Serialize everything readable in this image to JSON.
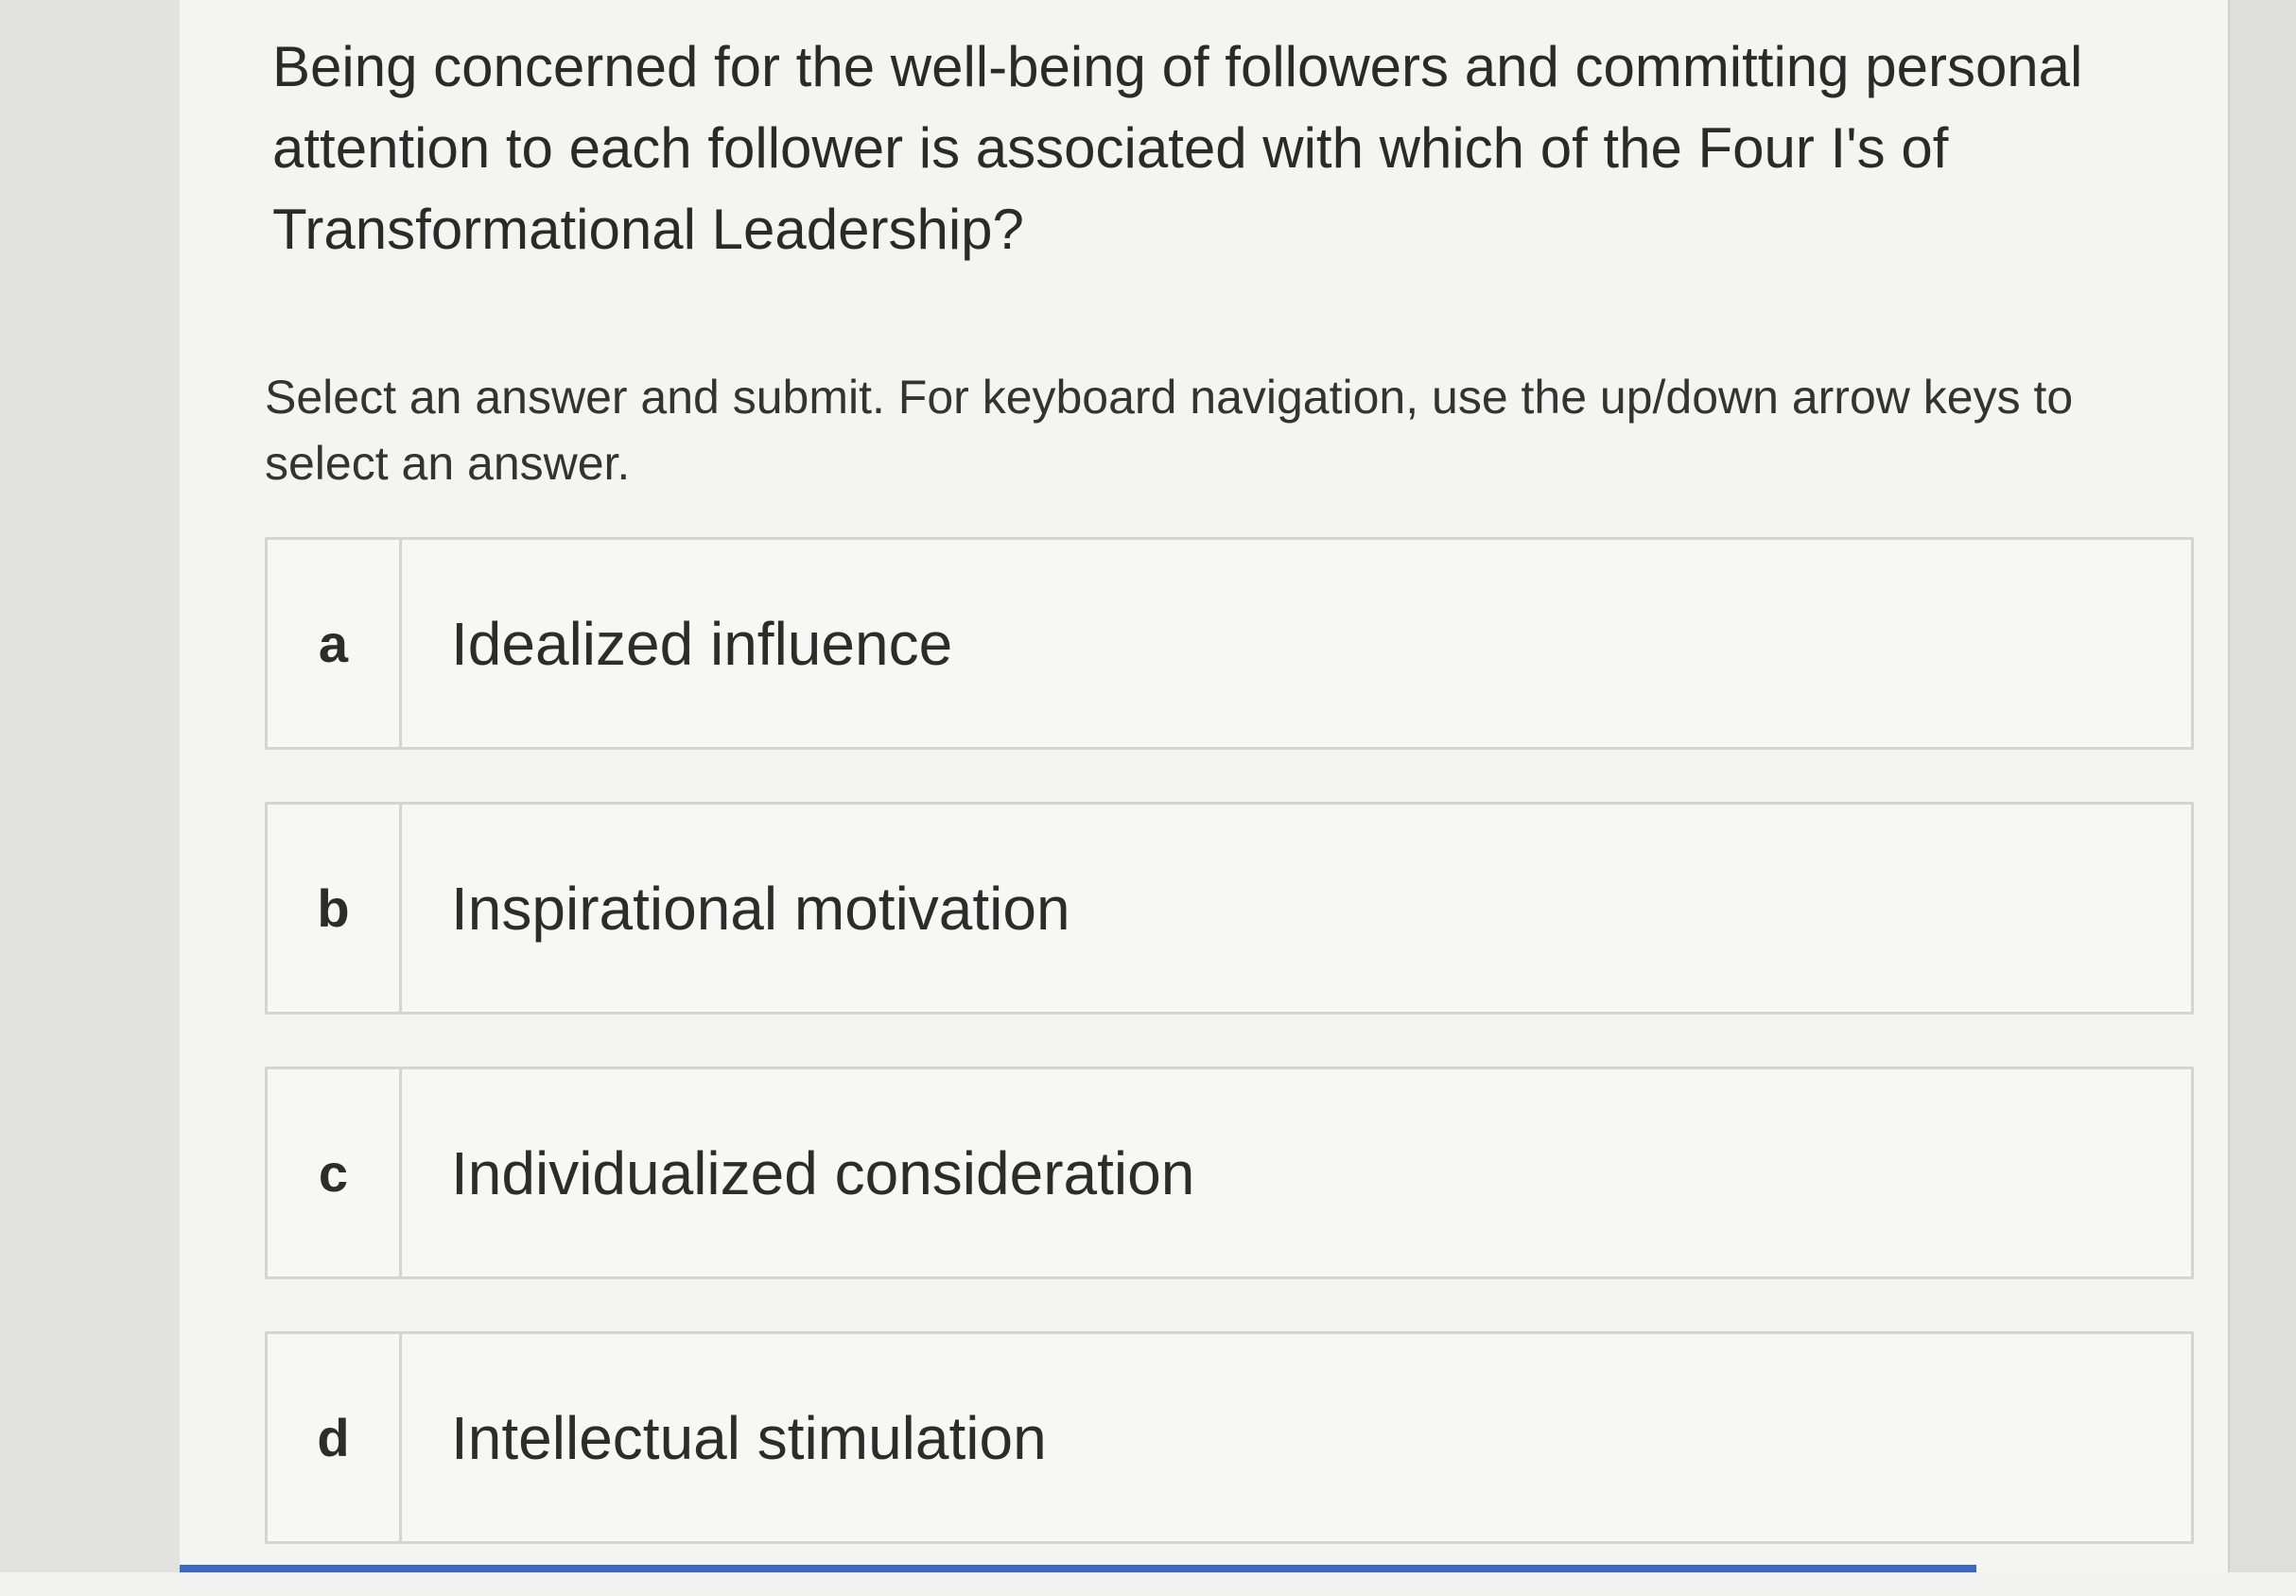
{
  "question": {
    "text": "Being concerned for the well-being of followers and committing personal attention to each follower is associated with which of the Four I's of Transformational Leadership?"
  },
  "instructions": "Select an answer and submit. For keyboard navigation, use the up/down arrow keys to select an answer.",
  "answers": [
    {
      "letter": "a",
      "label": "Idealized influence"
    },
    {
      "letter": "b",
      "label": "Inspirational motivation"
    },
    {
      "letter": "c",
      "label": "Individualized consideration"
    },
    {
      "letter": "d",
      "label": "Intellectual stimulation"
    }
  ],
  "colors": {
    "accent": "#3b69c9",
    "border": "#d4d4d0",
    "background": "#f4f4f2"
  }
}
